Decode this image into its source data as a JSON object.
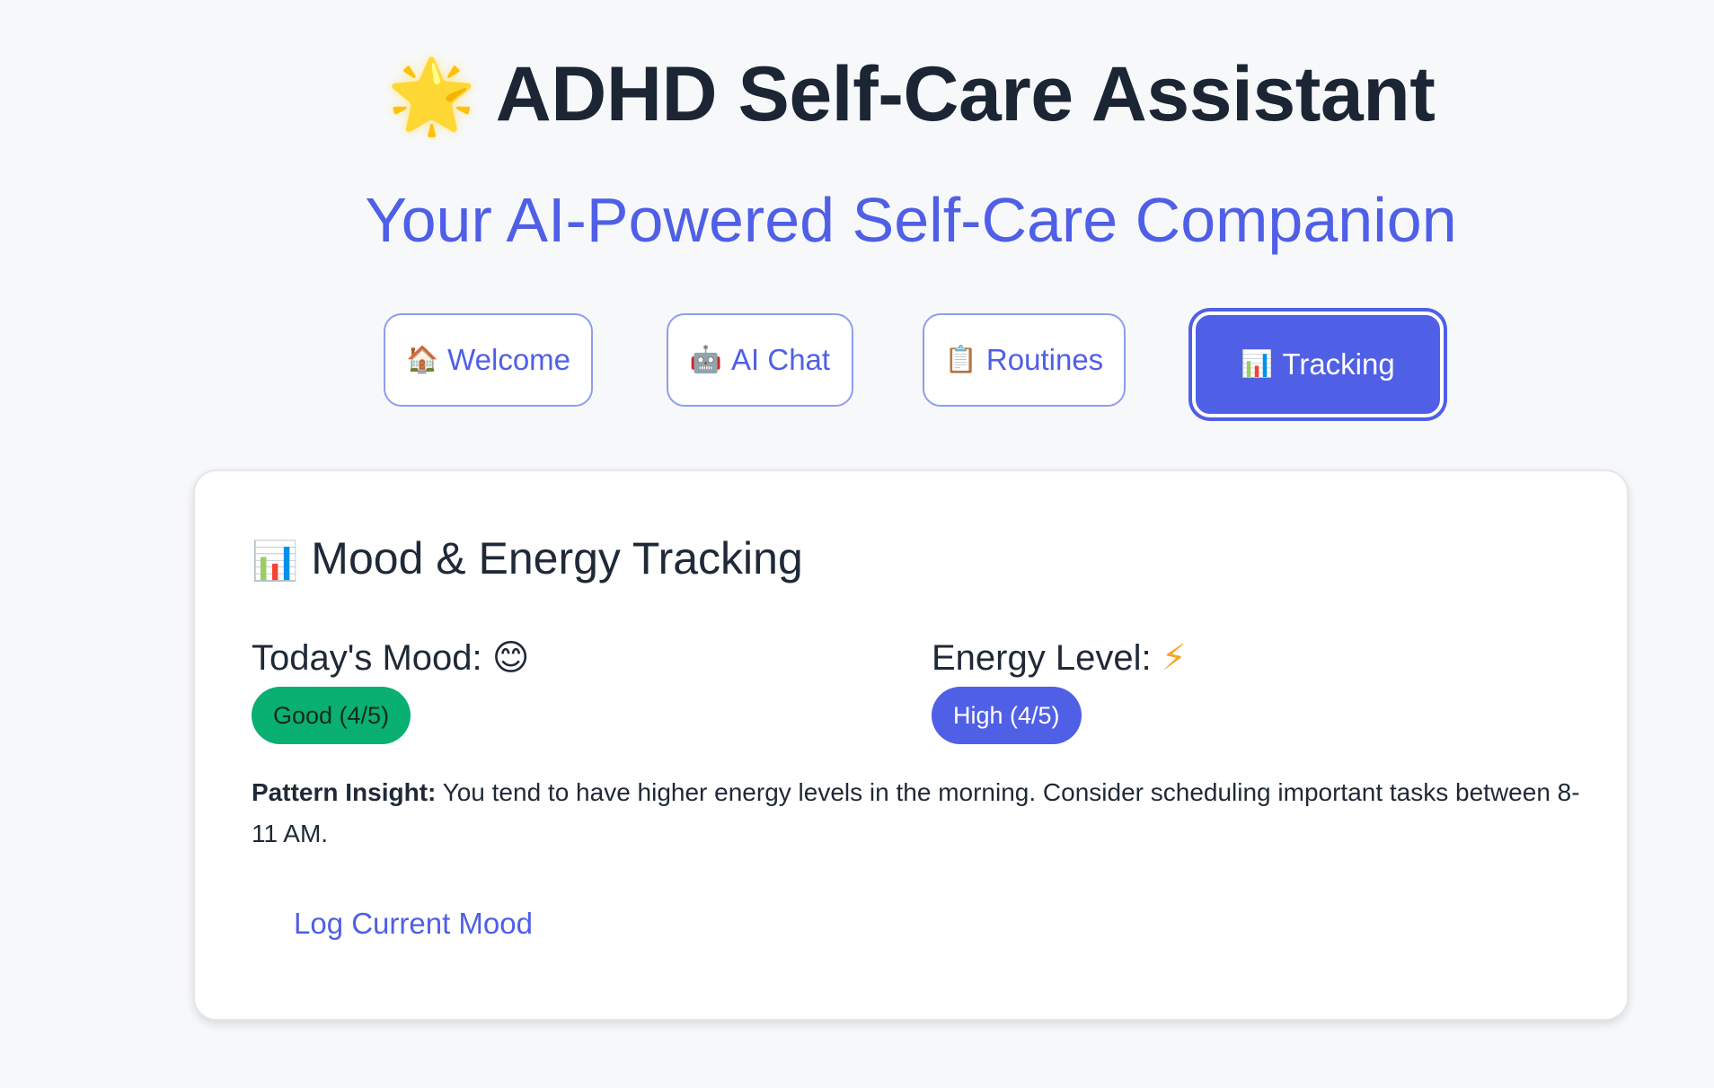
{
  "header": {
    "icon": "🌟",
    "title": "ADHD Self-Care Assistant",
    "subtitle": "Your AI-Powered Self-Care Companion"
  },
  "tabs": [
    {
      "icon": "🏠",
      "label": "Welcome",
      "active": false
    },
    {
      "icon": "🤖",
      "label": "AI Chat",
      "active": false
    },
    {
      "icon": "📋",
      "label": "Routines",
      "active": false
    },
    {
      "icon": "📊",
      "label": "Tracking",
      "active": true
    }
  ],
  "tracking": {
    "title_icon": "📊",
    "title": "Mood & Energy Tracking",
    "mood": {
      "label": "Today's Mood:",
      "icon": "😊",
      "value": "Good (4/5)",
      "color": "#0aaf72"
    },
    "energy": {
      "label": "Energy Level:",
      "icon": "⚡",
      "value": "High (4/5)",
      "color": "#4f5fe6"
    },
    "insight_label": "Pattern Insight:",
    "insight_text": " You tend to have higher energy levels in the morning. Consider scheduling important tasks between 8-11 AM.",
    "log_button": "Log Current Mood"
  },
  "colors": {
    "accent": "#4f5fe6",
    "background": "#f7f8fa"
  }
}
